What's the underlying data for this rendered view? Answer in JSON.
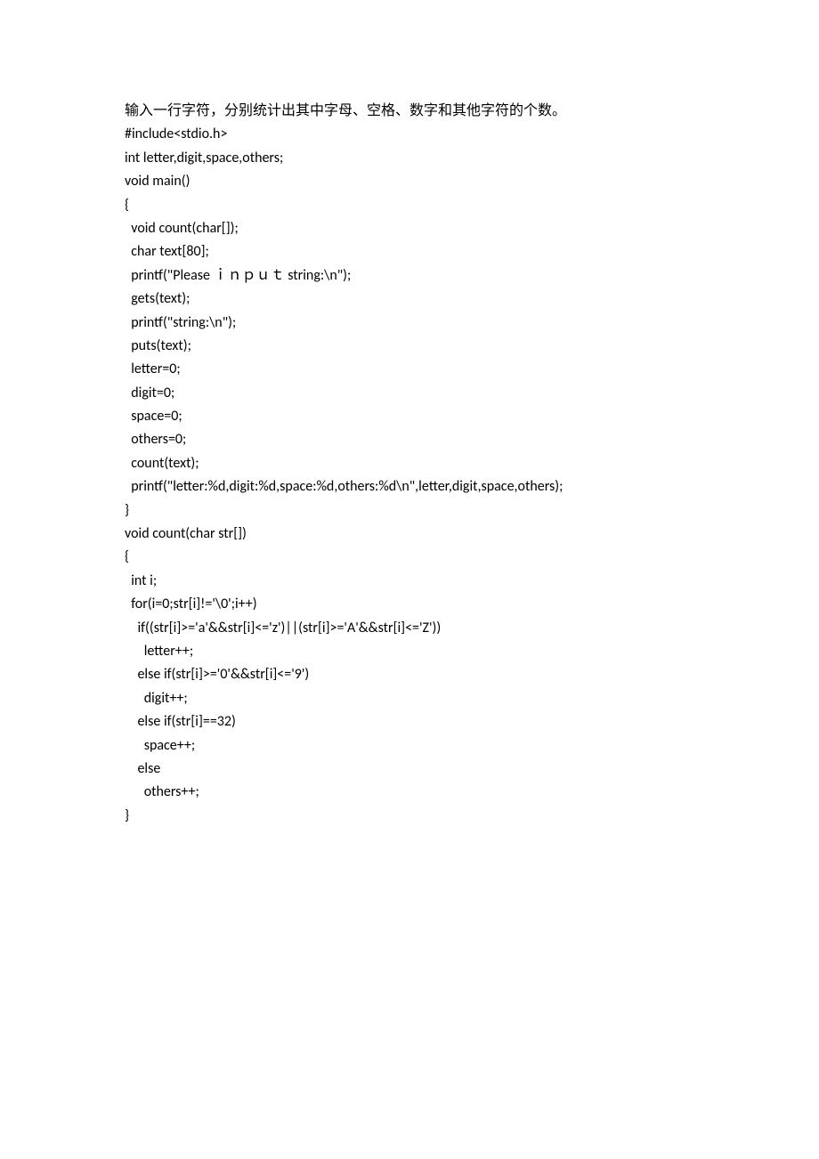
{
  "lines": [
    "输入一行字符，分别统计出其中字母、空格、数字和其他字符的个数。",
    "#include<stdio.h>",
    "int letter,digit,space,others;",
    "void main()",
    "{",
    "  void count(char[]);",
    "  char text[80];",
    "  printf(\"Please ｉｎｐｕｔ string:\\n\");",
    "  gets(text);",
    "  printf(\"string:\\n\");",
    "  puts(text);",
    "  letter=0;",
    "  digit=0;",
    "  space=0;",
    "  others=0;",
    "  count(text);",
    "  printf(\"letter:%d,digit:%d,space:%d,others:%d\\n\",letter,digit,space,others);",
    "}",
    "void count(char str[])",
    "{",
    "  int i;",
    "  for(i=0;str[i]!='\\0';i++)",
    "    if((str[i]>='a'&&str[i]<='z')||(str[i]>='A'&&str[i]<='Z'))",
    "      letter++;",
    "    else if(str[i]>='0'&&str[i]<='9')",
    "      digit++;",
    "    else if(str[i]==32)",
    "      space++;",
    "    else",
    "      others++;",
    "}"
  ]
}
